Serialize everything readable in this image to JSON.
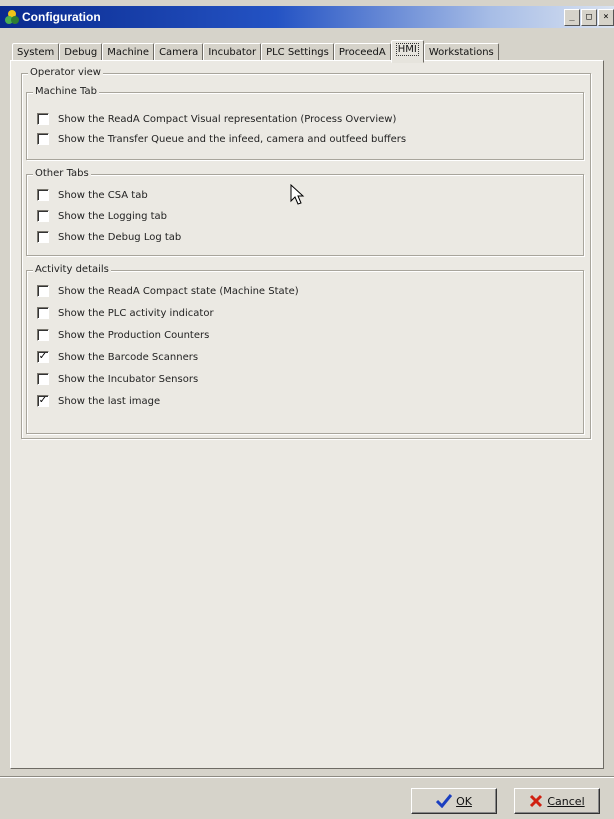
{
  "window": {
    "title": "Configuration",
    "controls": [
      "_",
      "□",
      "×"
    ]
  },
  "tabs": [
    {
      "label": "System",
      "active": false
    },
    {
      "label": "Debug",
      "active": false
    },
    {
      "label": "Machine",
      "active": false
    },
    {
      "label": "Camera",
      "active": false
    },
    {
      "label": "Incubator",
      "active": false
    },
    {
      "label": "PLC Settings",
      "active": false
    },
    {
      "label": "ProceedA",
      "active": false
    },
    {
      "label": "HMI",
      "active": true
    },
    {
      "label": "Workstations",
      "active": false
    }
  ],
  "operator_view": {
    "title": "Operator view",
    "machine_tab": {
      "title": "Machine Tab",
      "options": [
        {
          "label": "Show the ReadA Compact Visual representation (Process Overview)",
          "checked": false
        },
        {
          "label": "Show the Transfer Queue and the infeed, camera and outfeed buffers",
          "checked": false
        }
      ]
    },
    "other_tabs": {
      "title": "Other Tabs",
      "options": [
        {
          "label": "Show the CSA tab",
          "checked": false
        },
        {
          "label": "Show the Logging tab",
          "checked": false
        },
        {
          "label": "Show the Debug Log tab",
          "checked": false
        }
      ]
    },
    "activity_details": {
      "title": "Activity details",
      "options": [
        {
          "label": "Show the ReadA Compact state (Machine State)",
          "checked": false
        },
        {
          "label": "Show the PLC activity indicator",
          "checked": false
        },
        {
          "label": "Show the Production Counters",
          "checked": false
        },
        {
          "label": "Show the Barcode Scanners",
          "checked": true
        },
        {
          "label": "Show the Incubator Sensors",
          "checked": false
        },
        {
          "label": "Show the last image",
          "checked": true
        }
      ]
    }
  },
  "buttons": {
    "ok": {
      "label": "OK",
      "icon": "checkmark-icon",
      "color": "#1b3fc0"
    },
    "cancel": {
      "label": "Cancel",
      "icon": "red-x-icon",
      "color": "#d02010"
    }
  }
}
